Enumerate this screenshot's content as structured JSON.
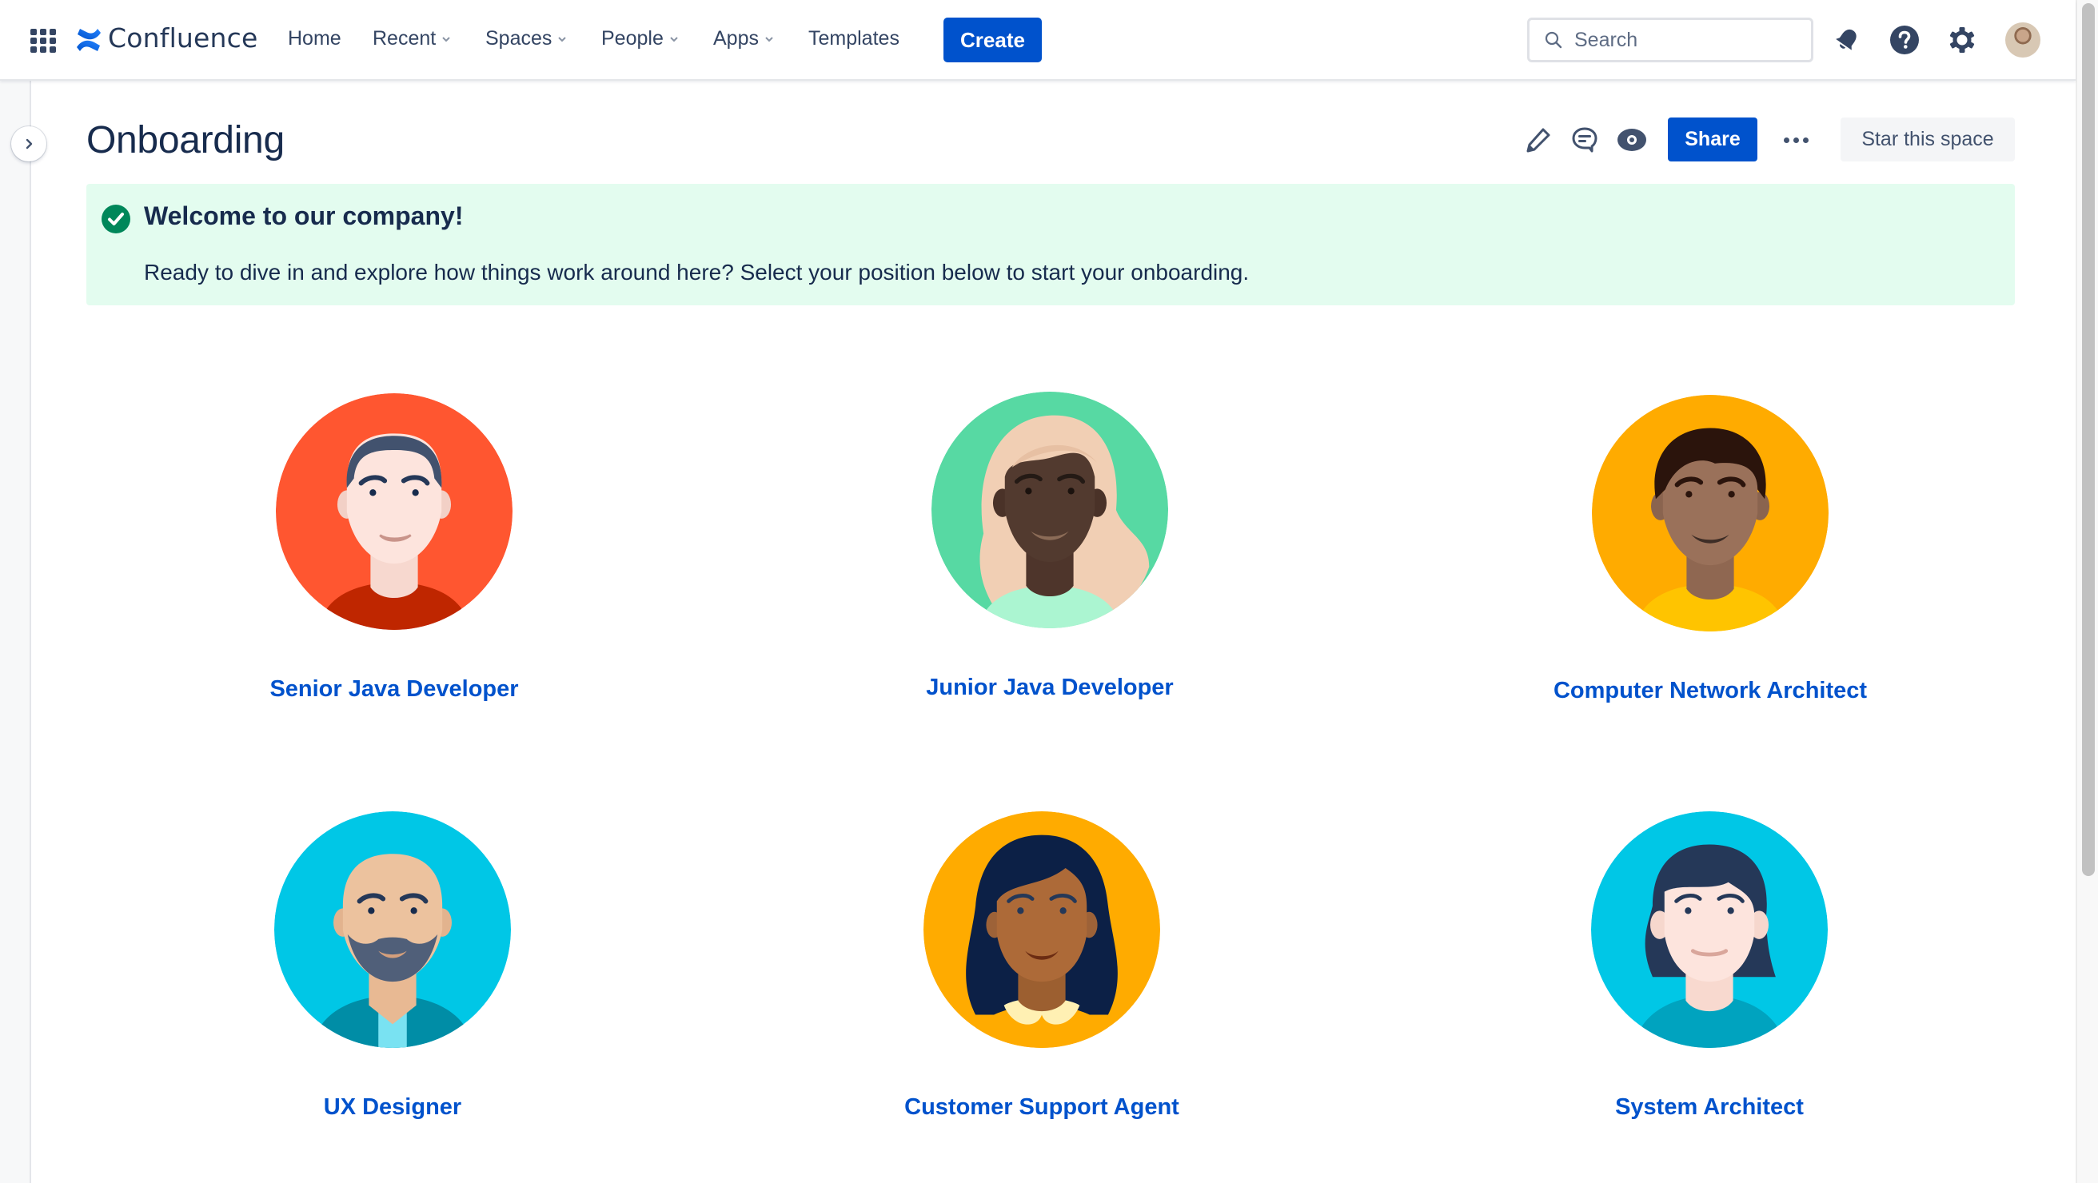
{
  "topnav": {
    "brand": "Confluence",
    "items": [
      {
        "label": "Home",
        "has_dropdown": false
      },
      {
        "label": "Recent",
        "has_dropdown": true
      },
      {
        "label": "Spaces",
        "has_dropdown": true
      },
      {
        "label": "People",
        "has_dropdown": true
      },
      {
        "label": "Apps",
        "has_dropdown": true
      },
      {
        "label": "Templates",
        "has_dropdown": false
      }
    ],
    "create_label": "Create",
    "search": {
      "placeholder": "Search",
      "value": ""
    },
    "icons": [
      "app-switcher-icon",
      "confluence-logo",
      "notifications-bell-icon",
      "help-icon",
      "settings-gear-icon",
      "user-avatar"
    ]
  },
  "page": {
    "title": "Onboarding",
    "actions": {
      "icons": [
        "edit-pencil-icon",
        "comment-icon",
        "watch-eye-icon",
        "more-actions-icon"
      ],
      "share_label": "Share",
      "star_label": "Star this space"
    }
  },
  "banner": {
    "title": "Welcome to our company!",
    "text": "Ready to dive in and explore how things work around here? Select your position below to start your onboarding.",
    "color": "#e3fcef",
    "icon": "success-check-icon"
  },
  "roles": [
    {
      "label": "Senior Java Developer",
      "bg": "#ff5630"
    },
    {
      "label": "Junior Java Developer",
      "bg": "#57d9a3"
    },
    {
      "label": "Computer Network Architect",
      "bg": "#ffab00"
    },
    {
      "label": "UX Designer",
      "bg": "#00c7e6"
    },
    {
      "label": "Customer Support Agent",
      "bg": "#ffab00"
    },
    {
      "label": "System Architect",
      "bg": "#00c7e6"
    }
  ],
  "colors": {
    "primary": "#0052cc",
    "text": "#172b4d",
    "link": "#0052cc",
    "success": "#00875a"
  }
}
